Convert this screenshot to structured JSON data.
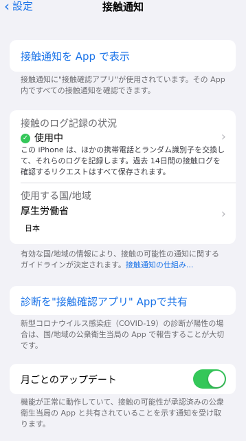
{
  "nav": {
    "back_label": "設定",
    "title": "接触通知"
  },
  "section_app": {
    "link": "接触通知を App で表示",
    "note": "接触通知に\"接触確認アプリ\"が使用されています。その App内ですべての接触通知を確認できます。"
  },
  "section_log": {
    "title": "接触のログ記録の状況",
    "status": "使用中",
    "description": "この iPhone は、ほかの携帯電話とランダム識別子を交換して、それらのログを記録します。過去 14日間の接触ログを確認するリクエストはすべて保存されます。",
    "region_title": "使用する国/地域",
    "region_value": "厚生労働省",
    "country": "日本"
  },
  "section_log_note": {
    "text": "有効な国/地域の情報により、接触の可能性の通知に関するガイドラインが決定されます。",
    "link": "接触通知の仕組み..."
  },
  "section_share": {
    "link": "診断を\"接触確認アプリ\" Appで共有",
    "note": "新型コロナウイルス感染症（COVID-19）の診断が陽性の場合は、国/地域の公衆衛生当局の App で報告することが大切です。"
  },
  "section_update": {
    "label": "月ごとのアップデート",
    "toggle_on": true,
    "note": "機能が正常に動作していて、接触の可能性が承認済みの公衆衛生当局の App と共有されていることを示す通知を受け取ります。"
  },
  "colors": {
    "accent": "#1a73e8",
    "toggle_on": "#34c759",
    "background": "#f2f2f7"
  }
}
